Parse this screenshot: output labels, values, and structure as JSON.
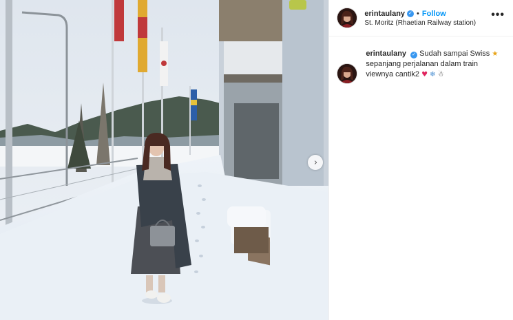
{
  "post": {
    "username": "erintaulany",
    "follow_label": "Follow",
    "separator": "•",
    "location": "St. Moritz (Rhaetian Railway station)",
    "more_label": "•••",
    "verified_mark": "✓",
    "next_arrow": "›"
  },
  "caption": {
    "username": "erintaulany",
    "text": "Sudah sampai Swiss",
    "text_line2": "sepanjang perjalanan dalam train viewnya cantik2",
    "emojis": {
      "starstruck": "★",
      "heart": "♥",
      "snowflake": "❄",
      "snowman": "☃"
    }
  },
  "icons": {
    "verified": "verified-badge-icon",
    "more": "more-options-icon",
    "next": "chevron-right-icon"
  },
  "colors": {
    "follow": "#0095f6",
    "verified": "#3897f0",
    "text": "#262626"
  }
}
